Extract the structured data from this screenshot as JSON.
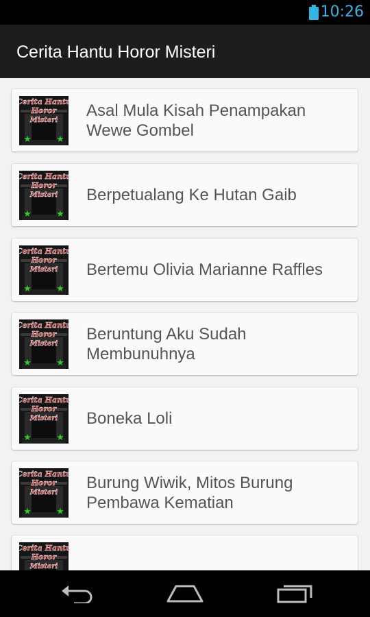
{
  "status_bar": {
    "time": "10:26",
    "icons": [
      "battery-icon"
    ],
    "accent_color": "#33b5e5"
  },
  "action_bar": {
    "title": "Cerita Hantu Horor Misteri"
  },
  "list": {
    "thumbnail_text": [
      "Cerita Hantu",
      "Horor",
      "Misteri"
    ],
    "items": [
      {
        "label": "Asal Mula Kisah Penampakan Wewe Gombel"
      },
      {
        "label": "Berpetualang Ke Hutan Gaib"
      },
      {
        "label": "Bertemu Olivia Marianne Raffles"
      },
      {
        "label": "Beruntung Aku Sudah Membunuhnya"
      },
      {
        "label": "Boneka Loli"
      },
      {
        "label": "Burung Wiwik, Mitos Burung Pembawa Kematian"
      },
      {
        "label": ""
      }
    ]
  },
  "nav_bar": {
    "icons": [
      "back-icon",
      "home-icon",
      "recent-apps-icon"
    ]
  }
}
